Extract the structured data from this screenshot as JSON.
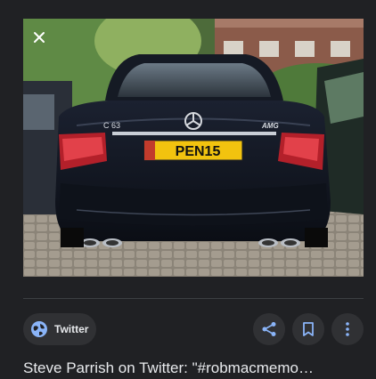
{
  "preview": {
    "image_alt": "Black Mercedes C63 AMG sedan seen from behind, parked on cobblestones",
    "badge_model": "C 63",
    "badge_amg": "AMG",
    "plate_text": "PEN15"
  },
  "controls": {
    "close_icon": "close-icon"
  },
  "source": {
    "name": "Twitter",
    "icon": "globe-icon"
  },
  "actions": {
    "share_icon": "share-icon",
    "save_icon": "bookmark-icon",
    "more_icon": "more-vert-icon"
  },
  "result": {
    "title": "Steve Parrish on Twitter: \"#robmacmemo…"
  },
  "colors": {
    "background": "#202124",
    "chip": "#303134",
    "accent": "#8ab4f8",
    "text": "#e8eaed"
  }
}
